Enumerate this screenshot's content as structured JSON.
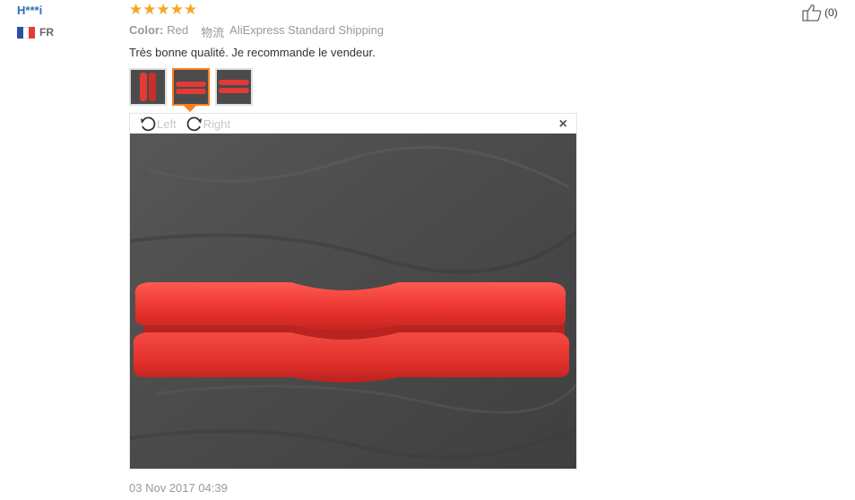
{
  "reviewer": {
    "name": "H***i",
    "country_code": "FR",
    "flag_colors": [
      "#2b4fa3",
      "#ffffff",
      "#e53b35"
    ]
  },
  "rating": {
    "stars": 5,
    "max": 5,
    "color": "#f5a623"
  },
  "sku": {
    "label": "Color:",
    "value": "Red",
    "shipping_label": "物流",
    "shipping_method": "AliExpress Standard Shipping"
  },
  "review": {
    "text": "Très bonne qualité. Je recommande le vendeur.",
    "date": "03 Nov 2017 04:39"
  },
  "thumbnails": {
    "count": 3,
    "active_index": 1,
    "accent": "#ff7e21"
  },
  "viewer": {
    "rotate_left_label": "Left",
    "rotate_right_label": "Right",
    "close_glyph": "×"
  },
  "helpful": {
    "count_label": "(0)",
    "icon": "thumbs-up-icon"
  }
}
